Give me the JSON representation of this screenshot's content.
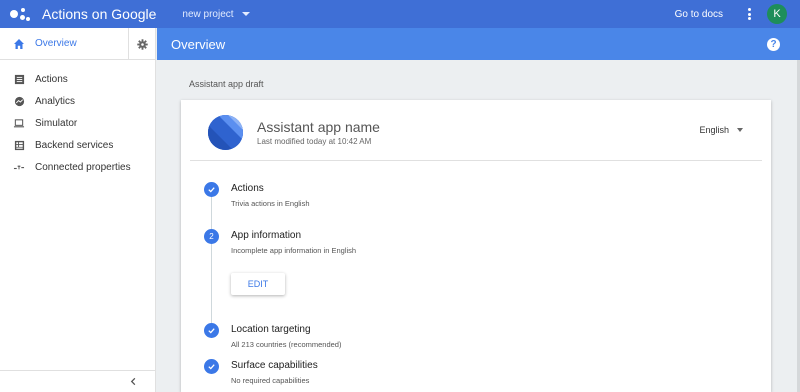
{
  "topbar": {
    "app_title": "Actions on Google",
    "project": "new project",
    "go_to_docs": "Go to docs",
    "avatar_letter": "K"
  },
  "sidebar": {
    "overview_label": "Overview",
    "items": [
      {
        "label": "Actions",
        "icon": "list-icon"
      },
      {
        "label": "Analytics",
        "icon": "analytics-icon"
      },
      {
        "label": "Simulator",
        "icon": "laptop-icon"
      },
      {
        "label": "Backend services",
        "icon": "backend-icon"
      },
      {
        "label": "Connected properties",
        "icon": "connected-icon"
      }
    ]
  },
  "main": {
    "header_title": "Overview",
    "section_label": "Assistant app draft",
    "card": {
      "app_name": "Assistant app name",
      "last_modified": "Last modified today at 10:42 AM",
      "language": "English",
      "steps": [
        {
          "title": "Actions",
          "subtitle": "Trivia actions in English",
          "status": "done"
        },
        {
          "title": "App information",
          "subtitle": "Incomplete app information in English",
          "status": "pending",
          "number": "2"
        },
        {
          "title": "Location targeting",
          "subtitle": "All 213 countries (recommended)",
          "status": "done"
        },
        {
          "title": "Surface capabilities",
          "subtitle": "No required capabilities",
          "status": "done"
        }
      ],
      "edit_label": "EDIT"
    }
  },
  "colors": {
    "topbar": "#3f6fd6",
    "header": "#4a86e8",
    "accent": "#3b78e7",
    "avatar": "#1e8e5a"
  }
}
